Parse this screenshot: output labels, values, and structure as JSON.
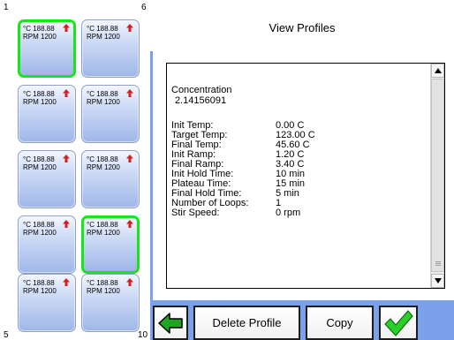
{
  "page": {
    "title": "View Profiles"
  },
  "grid": {
    "corner_top_left": "1",
    "corner_top_right": "6",
    "corner_bottom_left": "5",
    "corner_bottom_right": "10",
    "tiles": [
      {
        "temp_unit": "°C",
        "temp": "188.88",
        "rpm": "RPM 1200",
        "selected": true
      },
      {
        "temp_unit": "°C",
        "temp": "188.88",
        "rpm": "RPM 1200",
        "selected": false
      },
      {
        "temp_unit": "°C",
        "temp": "188.88",
        "rpm": "RPM 1200",
        "selected": false
      },
      {
        "temp_unit": "°C",
        "temp": "188.88",
        "rpm": "RPM 1200",
        "selected": false
      },
      {
        "temp_unit": "°C",
        "temp": "188.88",
        "rpm": "RPM 1200",
        "selected": false
      },
      {
        "temp_unit": "°C",
        "temp": "188.88",
        "rpm": "RPM 1200",
        "selected": false
      },
      {
        "temp_unit": "°C",
        "temp": "188.88",
        "rpm": "RPM 1200",
        "selected": false
      },
      {
        "temp_unit": "°C",
        "temp": "188.88",
        "rpm": "RPM 1200",
        "selected": false
      },
      {
        "temp_unit": "°C",
        "temp": "188.88",
        "rpm": "RPM 1200",
        "selected": true
      },
      {
        "temp_unit": "°C",
        "temp": "188.88",
        "rpm": "RPM 1200",
        "selected": false
      }
    ],
    "arrow_icon": "up-arrow-icon",
    "arrow_color": "#d81e1e",
    "selected_color": "#19e619"
  },
  "details": {
    "concentration_label": "Concentration",
    "concentration_value": "2.14156091",
    "rows": [
      {
        "label": "Init Temp:",
        "value": "0.00  C"
      },
      {
        "label": "Target Temp:",
        "value": "123.00  C"
      },
      {
        "label": "Final Temp:",
        "value": "45.60  C"
      },
      {
        "label": "Init Ramp:",
        "value": "1.20  C"
      },
      {
        "label": "Final Ramp:",
        "value": "3.40  C"
      },
      {
        "label": "Init Hold Time:",
        "value": "10 min"
      },
      {
        "label": "Plateau Time:",
        "value": "15 min"
      },
      {
        "label": "Final Hold Time:",
        "value": "5 min"
      },
      {
        "label": "Number of Loops:",
        "value": "1"
      },
      {
        "label": "Stir Speed:",
        "value": "0 rpm"
      }
    ]
  },
  "toolbar": {
    "back_icon": "back-arrow-icon",
    "delete_label": "Delete Profile",
    "copy_label": "Copy",
    "ok_icon": "checkmark-icon"
  },
  "colors": {
    "panel_blue": "#7aa1ea",
    "back_arrow_green": "#1fa51f",
    "check_green": "#2bcf2b"
  }
}
